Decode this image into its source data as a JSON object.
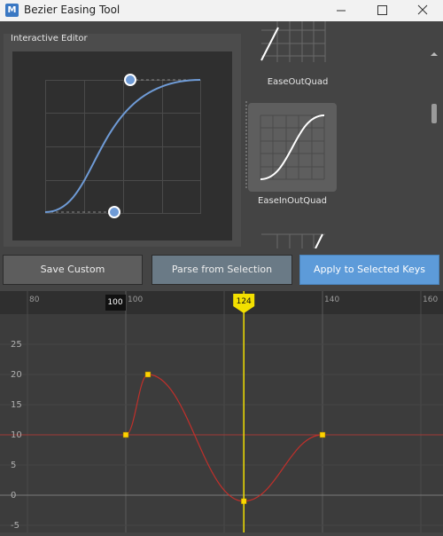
{
  "window": {
    "title": "Bezier Easing Tool",
    "app_icon_letter": "M"
  },
  "editor": {
    "label": "Interactive Editor"
  },
  "presets": [
    {
      "label": "EaseOutQuad"
    },
    {
      "label": "EaseInOutQuad"
    },
    {
      "label": ""
    }
  ],
  "buttons": {
    "save": "Save Custom",
    "parse": "Parse from Selection",
    "apply": "Apply to Selected Keys"
  },
  "graph": {
    "frame_ticks": [
      80,
      100,
      140,
      160
    ],
    "value_ticks": [
      25,
      20,
      15,
      10,
      5,
      0,
      -5
    ],
    "range_start_marker": "100",
    "current_frame": "124",
    "keys": [
      {
        "frame": 100,
        "value": 10
      },
      {
        "frame": 104.5,
        "value": 20
      },
      {
        "frame": 124,
        "value": -1
      },
      {
        "frame": 140,
        "value": 10
      }
    ]
  },
  "colors": {
    "accent": "#5d9bd9",
    "curve": "#6f9bd6",
    "anim_curve": "#c0302b",
    "key": "#ffd200",
    "playhead": "#f3e000"
  }
}
